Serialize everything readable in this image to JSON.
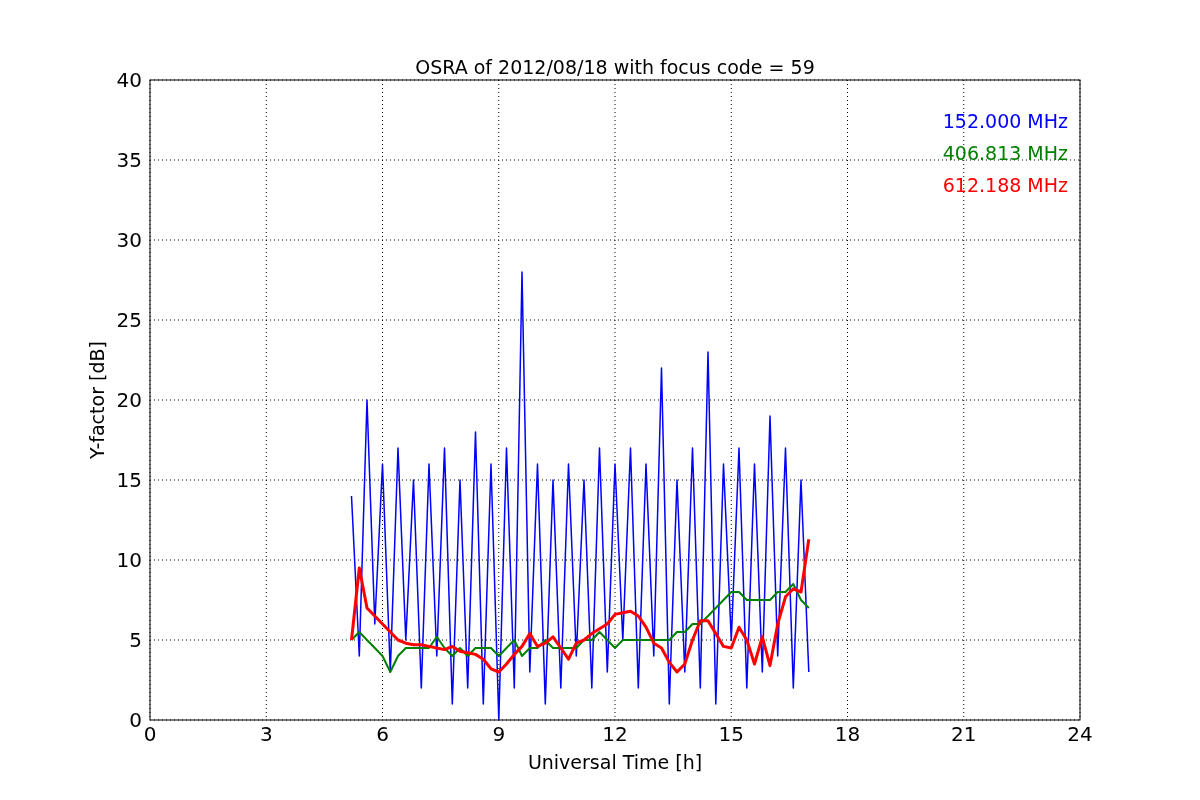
{
  "chart_data": {
    "type": "line",
    "title": "OSRA of 2012/08/18 with focus code = 59",
    "xlabel": "Universal Time [h]",
    "ylabel": "Y-factor [dB]",
    "grid": true,
    "xlim": [
      0,
      24
    ],
    "ylim": [
      0,
      40
    ],
    "xticks": [
      0,
      3,
      6,
      9,
      12,
      15,
      18,
      21,
      24
    ],
    "yticks": [
      0,
      5,
      10,
      15,
      20,
      25,
      30,
      35,
      40
    ],
    "x": [
      5.2,
      5.4,
      5.6,
      5.8,
      6.0,
      6.2,
      6.4,
      6.6,
      6.8,
      7.0,
      7.2,
      7.4,
      7.6,
      7.8,
      8.0,
      8.2,
      8.4,
      8.6,
      8.8,
      9.0,
      9.2,
      9.4,
      9.6,
      9.8,
      10.0,
      10.2,
      10.4,
      10.6,
      10.8,
      11.0,
      11.2,
      11.4,
      11.6,
      11.8,
      12.0,
      12.2,
      12.4,
      12.6,
      12.8,
      13.0,
      13.2,
      13.4,
      13.6,
      13.8,
      14.0,
      14.2,
      14.4,
      14.6,
      14.8,
      15.0,
      15.2,
      15.4,
      15.6,
      15.8,
      16.0,
      16.2,
      16.4,
      16.6,
      16.8,
      17.0
    ],
    "series": [
      {
        "name": "152.000 MHz",
        "color": "#0000ff",
        "values": [
          14,
          4,
          20,
          6,
          16,
          3,
          17,
          5,
          15,
          2,
          16,
          4,
          17,
          1,
          15,
          2,
          18,
          1,
          16,
          0,
          17,
          2,
          28,
          3,
          16,
          1,
          15,
          2,
          16,
          4,
          15,
          2,
          17,
          3,
          16,
          5,
          17,
          2,
          16,
          4,
          22,
          1,
          15,
          3,
          17,
          2,
          23,
          1,
          16,
          5,
          17,
          2,
          16,
          3,
          19,
          4,
          17,
          2,
          15,
          3
        ]
      },
      {
        "name": "406.813 MHz",
        "color": "#008000",
        "values": [
          5,
          5.5,
          5,
          4.5,
          4,
          3,
          4,
          4.5,
          4.5,
          4.5,
          4.5,
          5.2,
          4.5,
          4,
          4.5,
          4,
          4.5,
          4.5,
          4.5,
          4,
          4.5,
          5,
          4,
          4.5,
          4.5,
          5,
          4.5,
          4.5,
          4.5,
          4.5,
          5,
          5,
          5.5,
          5,
          4.5,
          5,
          5,
          5,
          5,
          5,
          5,
          5,
          5.5,
          5.5,
          6,
          6,
          6.5,
          7,
          7.5,
          8,
          8,
          7.5,
          7.5,
          7.5,
          7.5,
          8,
          8,
          8.5,
          7.5,
          7
        ]
      },
      {
        "name": "612.188 MHz",
        "color": "#ff0000",
        "values": [
          5,
          9.5,
          7,
          6.5,
          6,
          5.5,
          5,
          4.8,
          4.7,
          4.7,
          4.6,
          4.5,
          4.4,
          4.6,
          4.3,
          4.2,
          4.1,
          3.8,
          3.2,
          3.0,
          3.5,
          4.1,
          4.6,
          5.4,
          4.6,
          4.8,
          5.2,
          4.5,
          3.8,
          4.8,
          5.0,
          5.4,
          5.7,
          6.0,
          6.6,
          6.7,
          6.8,
          6.5,
          5.8,
          4.8,
          4.5,
          3.6,
          3.0,
          3.5,
          5.0,
          6.2,
          6.2,
          5.4,
          4.6,
          4.5,
          5.8,
          5.0,
          3.5,
          5.2,
          3.4,
          6.0,
          7.7,
          8.2,
          8.0,
          11.3
        ]
      }
    ]
  }
}
